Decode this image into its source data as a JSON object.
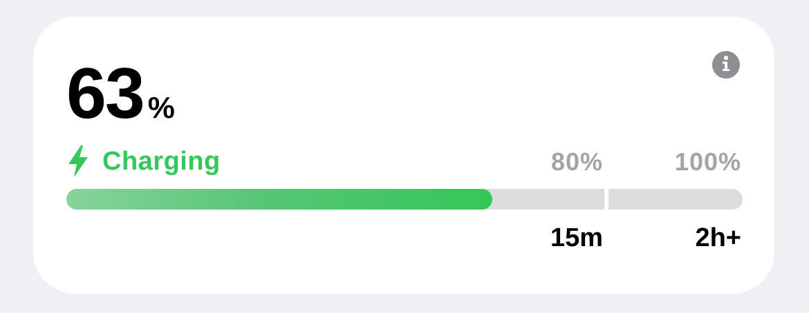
{
  "battery": {
    "level": "63",
    "unit": "%",
    "level_fraction": 0.63,
    "status": "Charging",
    "info_icon": "info-icon",
    "status_icon": "lightning-bolt-icon"
  },
  "markers": [
    {
      "label": "80%",
      "time": "15m"
    },
    {
      "label": "100%",
      "time": "2h+"
    }
  ],
  "colors": {
    "charging_green": "#34c759",
    "track_gray": "#dcdcde",
    "marker_gray": "#a3a3a8",
    "info_gray": "#8e8e93"
  }
}
